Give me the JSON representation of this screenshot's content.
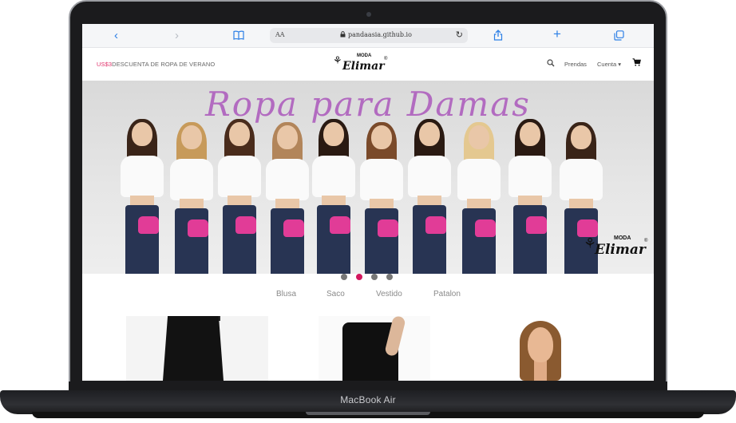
{
  "device": {
    "label": "MacBook Air"
  },
  "browser": {
    "text_size_label": "AA",
    "url": "pandaasia.github.io",
    "icons": [
      "back-icon",
      "forward-icon",
      "book-icon",
      "lock-icon",
      "reload-icon",
      "share-icon",
      "plus-icon",
      "tabs-icon"
    ]
  },
  "header": {
    "promo_price": "US$3",
    "promo_text": "DESCUENTA DE ROPA DE VERANO",
    "logo": {
      "top": "MODA",
      "name": "Elimar",
      "mark": "®"
    },
    "nav": {
      "prendas": "Prendas",
      "cuenta": "Cuenta ▾"
    }
  },
  "hero": {
    "title": "Ropa para Damas",
    "logo": {
      "top": "MODA",
      "name": "Elimar",
      "mark": "®"
    },
    "slide_count": 4,
    "active_slide": 2
  },
  "categories": [
    "Blusa",
    "Saco",
    "Vestido",
    "Patalon"
  ],
  "colors": {
    "accent": "#d3175e",
    "promo_price": "#e0306a",
    "hero_title": "#b26bc0",
    "link": "#2c7fe6"
  }
}
